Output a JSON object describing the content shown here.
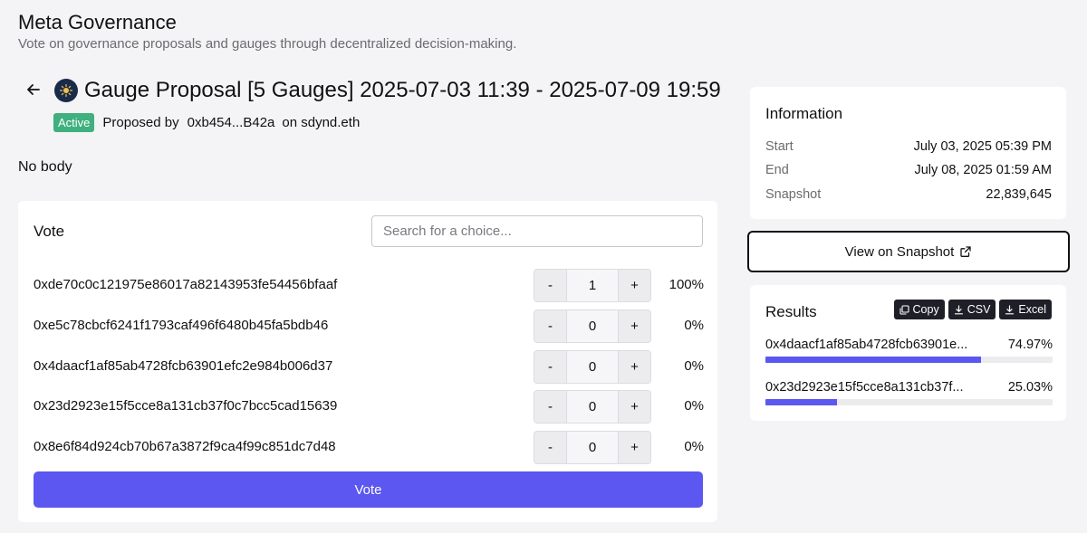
{
  "header": {
    "title": "Meta Governance",
    "subtitle": "Vote on governance proposals and gauges through decentralized decision-making."
  },
  "proposal": {
    "title": "Gauge Proposal [5 Gauges] 2025-07-03 11:39 - 2025-07-09 19:59",
    "status": "Active",
    "proposed_by_label": "Proposed by",
    "proposer": "0xb454...B42a",
    "space": "on sdynd.eth",
    "body": "No body"
  },
  "vote": {
    "title": "Vote",
    "search_placeholder": "Search for a choice...",
    "minus_label": "-",
    "plus_label": "+",
    "choices": [
      {
        "address": "0xde70c0c121975e86017a82143953fe54456bfaaf",
        "value": "1",
        "percent": "100%"
      },
      {
        "address": "0xe5c78cbcf6241f1793caf496f6480b45fa5bdb46",
        "value": "0",
        "percent": "0%"
      },
      {
        "address": "0x4daacf1af85ab4728fcb63901efc2e984b006d37",
        "value": "0",
        "percent": "0%"
      },
      {
        "address": "0x23d2923e15f5cce8a131cb37f0c7bcc5cad15639",
        "value": "0",
        "percent": "0%"
      },
      {
        "address": "0x8e6f84d924cb70b67a3872f9ca4f99c851dc7d48",
        "value": "0",
        "percent": "0%"
      }
    ],
    "button_label": "Vote"
  },
  "information": {
    "title": "Information",
    "rows": [
      {
        "label": "Start",
        "value": "July 03, 2025 05:39 PM"
      },
      {
        "label": "End",
        "value": "July 08, 2025 01:59 AM"
      },
      {
        "label": "Snapshot",
        "value": "22,839,645"
      }
    ]
  },
  "snapshot_link": {
    "label": "View on Snapshot",
    "icon": "external-link-icon"
  },
  "results": {
    "title": "Results",
    "exports": [
      {
        "label": "Copy",
        "icon": "copy-icon"
      },
      {
        "label": "CSV",
        "icon": "download-icon"
      },
      {
        "label": "Excel",
        "icon": "download-icon"
      }
    ],
    "items": [
      {
        "label": "0x4daacf1af85ab4728fcb63901e...",
        "percent": "74.97%",
        "fraction": 0.7497
      },
      {
        "label": "0x23d2923e15f5cce8a131cb37f...",
        "percent": "25.03%",
        "fraction": 0.2503
      }
    ]
  },
  "colors": {
    "accent": "#5b57f0",
    "active_badge": "#3fb07e",
    "dark_button": "#1f1f28",
    "background": "#f4f4f6"
  }
}
